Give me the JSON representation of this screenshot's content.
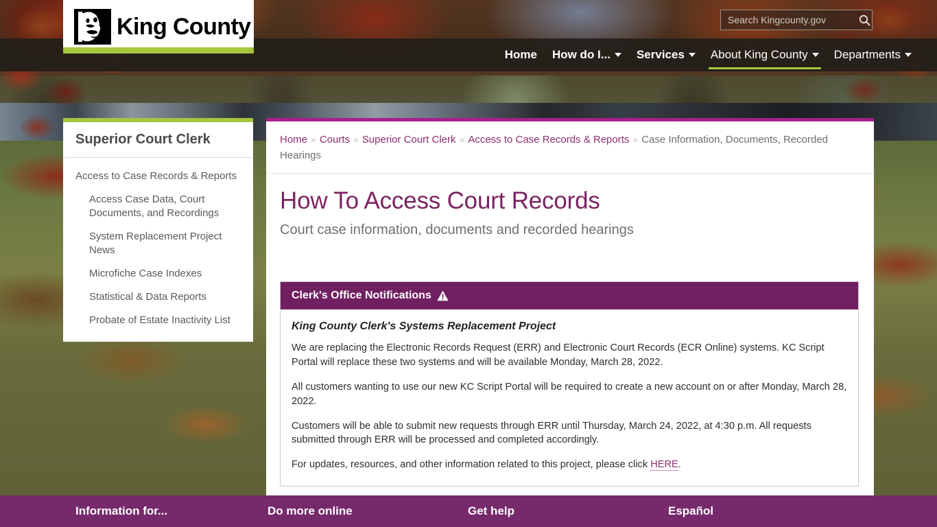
{
  "header": {
    "logo": {
      "mark_icon": "mlk-portrait-icon",
      "wordmark": "King County"
    },
    "nav": [
      {
        "label": "Home",
        "has_caret": false,
        "bold": true,
        "active": false
      },
      {
        "label": "How do I...",
        "has_caret": true,
        "bold": true,
        "active": false
      },
      {
        "label": "Services",
        "has_caret": true,
        "bold": true,
        "active": false
      },
      {
        "label": "About King County",
        "has_caret": true,
        "bold": false,
        "active": true
      },
      {
        "label": "Departments",
        "has_caret": true,
        "bold": false,
        "active": false
      }
    ],
    "search": {
      "placeholder": "Search Kingcounty.gov",
      "value": "",
      "button_icon": "search-icon"
    }
  },
  "sidebar": {
    "title": "Superior Court Clerk",
    "items": [
      {
        "label": "Access to Case Records & Reports",
        "level": 0
      },
      {
        "label": "Access Case Data, Court Documents, and Recordings",
        "level": 1
      },
      {
        "label": "System Replacement Project News",
        "level": 1
      },
      {
        "label": "Microfiche Case Indexes",
        "level": 1
      },
      {
        "label": "Statistical & Data Reports",
        "level": 1
      },
      {
        "label": "Probate of Estate Inactivity List",
        "level": 1
      }
    ]
  },
  "breadcrumb": {
    "separator": "»",
    "items": [
      {
        "label": "Home",
        "current": false
      },
      {
        "label": "Courts",
        "current": false
      },
      {
        "label": "Superior Court Clerk",
        "current": false
      },
      {
        "label": "Access to Case Records & Reports",
        "current": false
      },
      {
        "label": "Case Information, Documents, Recorded Hearings",
        "current": true
      }
    ]
  },
  "page": {
    "title": "How To Access Court Records",
    "subtitle": "Court case information, documents and recorded hearings"
  },
  "notification": {
    "header_label": "Clerk's Office Notifications",
    "header_icon": "warning-triangle-icon",
    "subtitle": "King County Clerk's Systems Replacement Project",
    "paragraphs": [
      "We are replacing the Electronic Records Request (ERR) and Electronic Court Records (ECR Online) systems. KC Script Portal will replace these two systems and will be available Monday, March 28, 2022.",
      "All customers wanting to use our new KC Script Portal will be required to create a new account on or after Monday, March 28, 2022.",
      "Customers will be able to submit new requests through ERR until Thursday, March 24, 2022, at 4:30 p.m. All requests submitted through ERR will be processed and completed accordingly."
    ],
    "last_paragraph": {
      "before": "For updates, resources, and other information related to this project, please click ",
      "link": "HERE",
      "after": "."
    }
  },
  "footer": {
    "columns": [
      {
        "label": "Information for..."
      },
      {
        "label": "Do more online"
      },
      {
        "label": "Get help"
      },
      {
        "label": "Español"
      }
    ]
  },
  "colors": {
    "green_accent": "#a6c63d",
    "magenta_rule": "#a71f8d",
    "purple_panel": "#702061",
    "purple_footer": "#76296b",
    "title_purple": "#7b2463",
    "link_purple": "#8e2d6e"
  }
}
